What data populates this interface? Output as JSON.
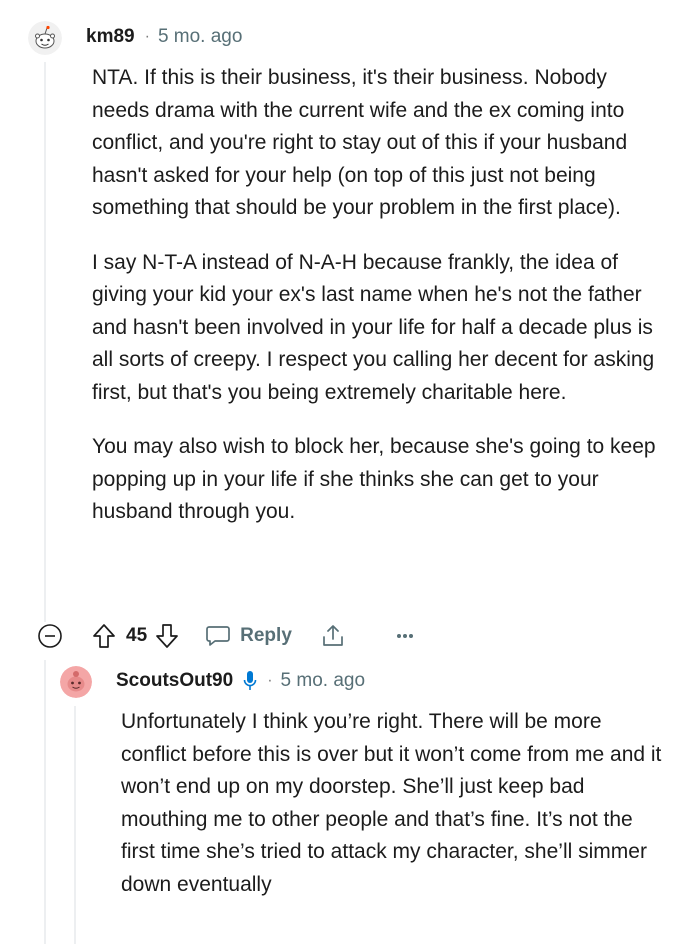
{
  "comment": {
    "username": "km89",
    "separator": "·",
    "timestamp": "5 mo. ago",
    "paragraphs": [
      "NTA. If this is their business, it's their business. Nobody needs drama with the current wife and the ex coming into conflict, and you're right to stay out of this if your husband hasn't asked for your help (on top of this just not being something that should be your problem in the first place).",
      "I say N-T-A instead of N-A-H because frankly, the idea of giving your kid your ex's last name when he's not the father and hasn't been involved in your life for half a decade plus is all sorts of creepy. I respect you calling her decent for asking first, but that's you being extremely charitable here.",
      "You may also wish to block her, because she's going to keep popping up in your life if she thinks she can get to your husband through you."
    ],
    "vote_count": "45",
    "reply_label": "Reply",
    "more_label": "···"
  },
  "reply": {
    "username": "ScoutsOut90",
    "separator": "·",
    "timestamp": "5 mo. ago",
    "text": "Unfortunately I think you’re right. There will be more conflict before this is over but it won’t come from me and it won’t end up on my doorstep. She’ll just keep bad mouthing me to other people and that’s fine. It’s not the first time she’s tried to attack my character, she’ll simmer down eventually"
  },
  "colors": {
    "text": "#1c1c1c",
    "meta": "#576f76",
    "thread_line": "#edeff1",
    "reply_avatar": "#f4a6a6",
    "mic_icon": "#0079d3"
  },
  "icons": {
    "avatar_1": "snoo-avatar-icon",
    "avatar_2": "snoo-avatar-icon",
    "collapse": "collapse-minus-icon",
    "upvote": "upvote-arrow-icon",
    "downvote": "downvote-arrow-icon",
    "reply": "comment-bubble-icon",
    "share": "share-icon",
    "mic": "microphone-icon"
  }
}
